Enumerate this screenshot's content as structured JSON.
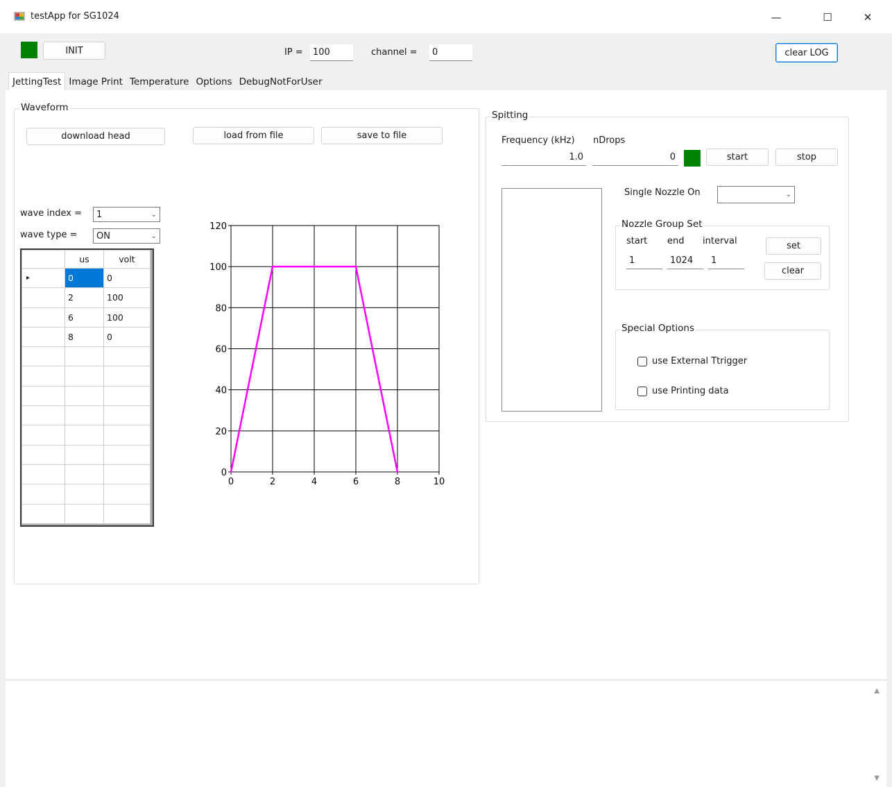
{
  "window": {
    "title": "testApp for SG1024",
    "minimize": "—",
    "maximize": "☐",
    "close": "✕"
  },
  "top": {
    "init_label": "INIT",
    "ip_label": "IP =",
    "ip_value": "100",
    "channel_label": "channel =",
    "channel_value": "0",
    "clear_log_label": "clear LOG",
    "status_led_color": "#008000"
  },
  "tabs": [
    {
      "label": "JettingTest",
      "active": true
    },
    {
      "label": "Image Print"
    },
    {
      "label": "Temperature"
    },
    {
      "label": "Options"
    },
    {
      "label": "DebugNotForUser"
    }
  ],
  "waveform": {
    "group_title": "Waveform",
    "download_label": "download head",
    "load_label": "load from file",
    "save_label": "save to file",
    "wave_index_label": "wave index =",
    "wave_index_value": "1",
    "wave_type_label": "wave type =",
    "wave_type_value": "ON",
    "grid": {
      "columns": [
        "us",
        "volt"
      ],
      "row_indicator": "▸",
      "rows": [
        [
          "0",
          "0"
        ],
        [
          "2",
          "100"
        ],
        [
          "6",
          "100"
        ],
        [
          "8",
          "0"
        ],
        [
          "",
          ""
        ],
        [
          "",
          ""
        ],
        [
          "",
          ""
        ],
        [
          "",
          ""
        ],
        [
          "",
          ""
        ],
        [
          "",
          ""
        ],
        [
          "",
          ""
        ],
        [
          "",
          ""
        ],
        [
          "",
          ""
        ]
      ]
    }
  },
  "chart_data": {
    "type": "line",
    "title": "",
    "xlabel": "",
    "ylabel": "",
    "xlim": [
      0,
      10
    ],
    "ylim": [
      0,
      120
    ],
    "xticks": [
      "0",
      "2",
      "4",
      "6",
      "8",
      "10"
    ],
    "yticks": [
      "0",
      "20",
      "40",
      "60",
      "80",
      "100",
      "120"
    ],
    "grid": true,
    "series": [
      {
        "x": [
          0,
          2,
          6,
          8
        ],
        "y": [
          0,
          100,
          100,
          0
        ],
        "color": "#ff00ff"
      }
    ]
  },
  "spitting": {
    "group_title": "Spitting",
    "frequency_label": "Frequency (kHz)",
    "frequency_value": "1.0",
    "ndrops_label": "nDrops",
    "ndrops_value": "0",
    "led_color": "#008000",
    "start_label": "start",
    "stop_label": "stop",
    "single_nozzle_label": "Single Nozzle On",
    "single_nozzle_value": "",
    "nozzle_group": {
      "title": "Nozzle Group Set",
      "start_label": "start",
      "end_label": "end",
      "interval_label": "interval",
      "start_value": "1",
      "end_value": "1024",
      "interval_value": "1",
      "set_label": "set",
      "clear_label": "clear"
    },
    "special": {
      "title": "Special Options",
      "ext_trigger_label": "use External Ttrigger",
      "printing_data_label": "use Printing data"
    }
  },
  "log": {
    "scroll_up": "▲",
    "scroll_down": "▼"
  }
}
